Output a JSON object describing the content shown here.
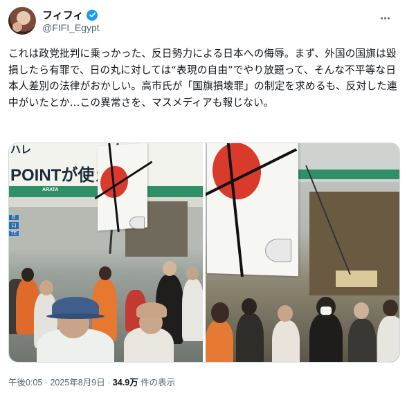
{
  "author": {
    "display_name": "フィフィ",
    "handle": "@FIFI_Egypt",
    "verified": true,
    "verified_color": "#1d9bf0"
  },
  "tweet": {
    "text": "これは政党批判に乗っかった、反日勢力による日本への侮辱。まず、外国の国旗は毀損したら有罪で、日の丸に対しては“表現の自由”でやり放題って、そんな不平等な日本人差別の法律がおかしい。高市氏が「国旗損壊罪」の制定を求めるも、反対した連中がいたとか…この異常さを、マスメディアも報じない。"
  },
  "media": {
    "left_photo": {
      "signage_katakana": "ハレ",
      "signage_main": "POINTが使え",
      "signage_sub": "ARATA",
      "side_marks": [
        "B",
        "口",
        "TE"
      ]
    },
    "right_photo": {}
  },
  "meta": {
    "time": "午後0:05",
    "separator": "·",
    "date": "2025年8月9日",
    "views_count": "34.9万",
    "views_label": "件の表示"
  },
  "colors": {
    "text_primary": "#0f1419",
    "text_secondary": "#536471",
    "flag_red": "#d93a2c",
    "signage_green": "#2f8f66"
  },
  "icons": [
    "verified-badge-icon",
    "more-options-icon"
  ]
}
